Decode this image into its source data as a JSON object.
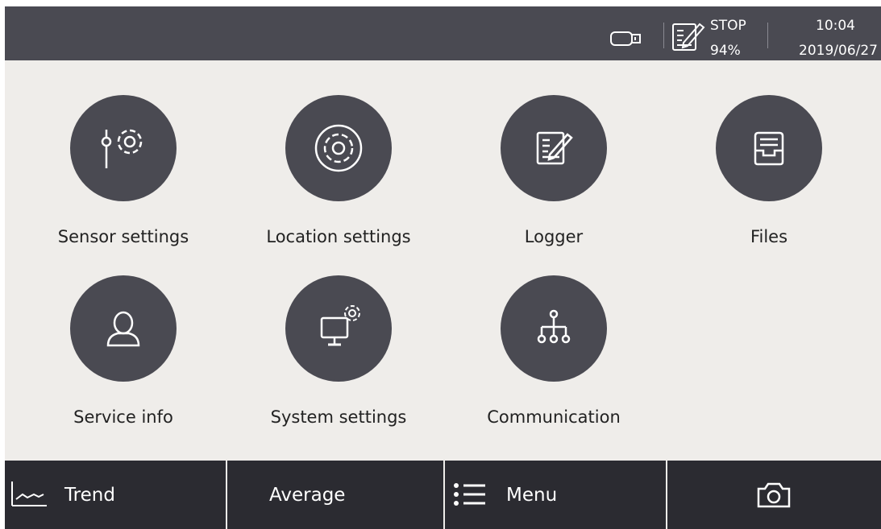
{
  "header": {
    "logger_status": "STOP",
    "memory_usage": "94%",
    "time": "10:04",
    "date": "2019/06/27",
    "icons": [
      "usb-stick-icon",
      "logger-icon"
    ]
  },
  "grid": {
    "items": [
      {
        "label": "Sensor settings",
        "icon": "sensor-settings-icon"
      },
      {
        "label": "Location settings",
        "icon": "location-gear-icon"
      },
      {
        "label": "Logger",
        "icon": "logger-edit-icon"
      },
      {
        "label": "Files",
        "icon": "files-tray-icon"
      },
      {
        "label": "Service info",
        "icon": "person-icon"
      },
      {
        "label": "System settings",
        "icon": "monitor-gear-icon"
      },
      {
        "label": "Communication",
        "icon": "network-tree-icon"
      }
    ]
  },
  "bottom_bar": {
    "trend_label": "Trend",
    "average_label": "Average",
    "menu_label": "Menu",
    "icons": [
      "trend-chart-icon",
      "menu-list-icon",
      "camera-icon"
    ]
  },
  "colors": {
    "header_bg": "#4a4a52",
    "content_bg": "#efedea",
    "circle_bg": "#4a4a52",
    "bottom_bg": "#2b2b31",
    "text_dark": "#222222",
    "text_light": "#ffffff"
  }
}
